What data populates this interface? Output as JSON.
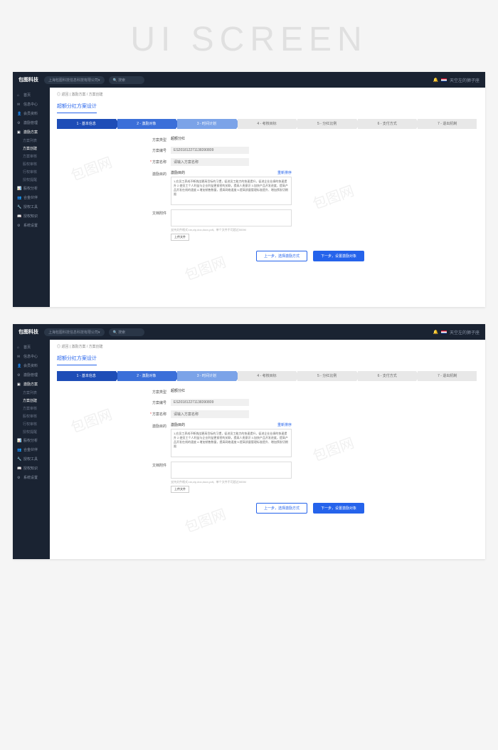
{
  "bg_title": "UI SCREEN",
  "header": {
    "logo": "包图科技",
    "company": "上海包图科技信息科技有限公司▾",
    "search_placeholder": "搜索",
    "notification_icon": "bell",
    "user_name": "天空左的狮子座"
  },
  "sidebar": {
    "items": [
      {
        "icon": "home",
        "label": "首页"
      },
      {
        "icon": "msg",
        "label": "信息中心"
      },
      {
        "icon": "member",
        "label": "会员资料"
      },
      {
        "icon": "manage",
        "label": "激励管理"
      },
      {
        "icon": "plan",
        "label": "激励方案",
        "active": true
      },
      {
        "icon": "analysis",
        "label": "股权分析"
      },
      {
        "icon": "partner",
        "label": "合金伙伴"
      },
      {
        "icon": "tool",
        "label": "授权工具"
      },
      {
        "icon": "know",
        "label": "授权知识"
      },
      {
        "icon": "setting",
        "label": "系统设置"
      }
    ],
    "subs": [
      {
        "label": "方案列表"
      },
      {
        "label": "方案创建",
        "active": true
      },
      {
        "label": "方案审核"
      },
      {
        "label": "股权审核"
      },
      {
        "label": "行权审核"
      },
      {
        "label": "授权提醒"
      }
    ]
  },
  "breadcrumb": {
    "home": "◎ 返回",
    "path1": "激励方案",
    "path2": "方案创建"
  },
  "page_title": "超额分红方案设计",
  "steps": [
    {
      "label": "1 - 基本信息",
      "cls": "s1"
    },
    {
      "label": "2 - 激励对象",
      "cls": "s2"
    },
    {
      "label": "3 - 时间计划",
      "cls": "s3"
    },
    {
      "label": "4 - 考核目标",
      "cls": "sg"
    },
    {
      "label": "5 - 分红比例",
      "cls": "sg"
    },
    {
      "label": "6 - 支付方式",
      "cls": "sg"
    },
    {
      "label": "7 - 退出机制",
      "cls": "sg"
    }
  ],
  "form": {
    "type_label": "方案类型",
    "type_value": "超额分红",
    "code_label": "方案编号",
    "code_value": "ES201812271138390809",
    "name_label": "方案名称",
    "name_placeholder": "请输入方案名称",
    "target_label": "激励目的",
    "target_title": "激励目的",
    "target_link": "重新排序",
    "target_body": "1.应员工养成不断挑战更高目标的习惯，促进员工能力的快速提升，促进企业业绩的快速提升\n2.使员工个人利益与企业利益更紧密的关联，提高人责意识\n3.加快产品开发进度，提高产品开发在线的速度\n4.增加销售数量，提高网络速度\n5.提高质量管理标准提升、增加预发切期限",
    "attach_label": "文档附件",
    "attach_hint": "支持文件格式:rar,zip,doc,docx,pdf，单个文件不可超过500M",
    "upload_btn": "上传文件"
  },
  "buttons": {
    "prev": "上一步，选择激励方式",
    "next": "下一步，设置激励对象"
  },
  "watermark": "包图网"
}
